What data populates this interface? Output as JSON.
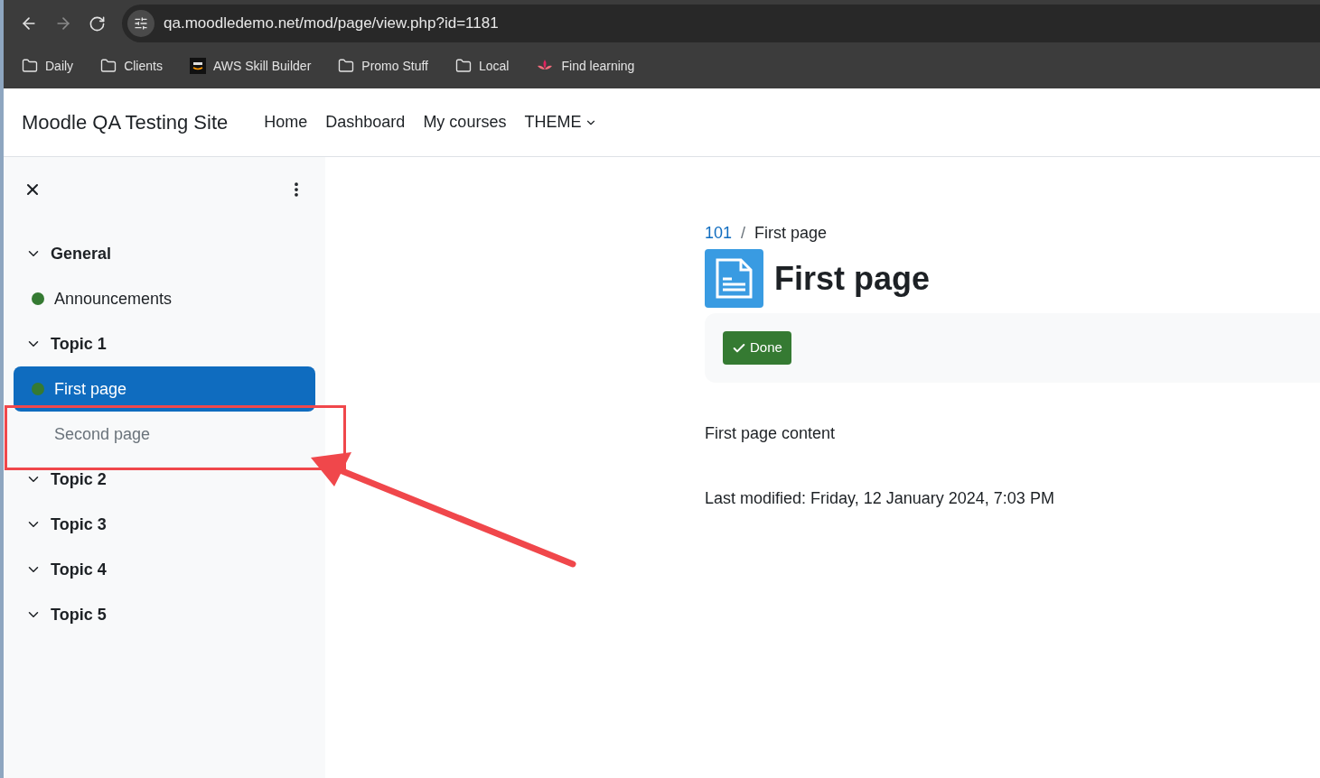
{
  "browser": {
    "url": "qa.moodledemo.net/mod/page/view.php?id=1181",
    "bookmarks": [
      {
        "label": "Daily",
        "kind": "folder"
      },
      {
        "label": "Clients",
        "kind": "folder"
      },
      {
        "label": "AWS Skill Builder",
        "kind": "aws"
      },
      {
        "label": "Promo Stuff",
        "kind": "folder"
      },
      {
        "label": "Local",
        "kind": "folder"
      },
      {
        "label": "Find learning",
        "kind": "app"
      }
    ]
  },
  "navbar": {
    "site_name": "Moodle QA Testing Site",
    "links": [
      {
        "label": "Home",
        "kind": "link"
      },
      {
        "label": "Dashboard",
        "kind": "link"
      },
      {
        "label": "My courses",
        "kind": "link"
      },
      {
        "label": "THEME",
        "kind": "dropdown"
      }
    ]
  },
  "course_index": {
    "sections": [
      {
        "title": "General",
        "expanded": true,
        "children": [
          {
            "title": "Announcements",
            "completed": true,
            "selected": false,
            "disabled": false
          }
        ]
      },
      {
        "title": "Topic 1",
        "expanded": true,
        "children": [
          {
            "title": "First page",
            "completed": true,
            "selected": true,
            "disabled": false
          },
          {
            "title": "Second page",
            "completed": false,
            "selected": false,
            "disabled": true
          }
        ]
      },
      {
        "title": "Topic 2",
        "expanded": true
      },
      {
        "title": "Topic 3",
        "expanded": true
      },
      {
        "title": "Topic 4",
        "expanded": true
      },
      {
        "title": "Topic 5",
        "expanded": true
      }
    ]
  },
  "main": {
    "breadcrumb_separator": "/",
    "breadcrumb": [
      {
        "label": "101",
        "kind": "link"
      },
      {
        "label": "First page",
        "kind": "current"
      }
    ],
    "title": "First page",
    "completion": {
      "label": "Done",
      "done": true
    },
    "content": "First page content",
    "last_modified": "Last modified: Friday, 12 January 2024, 7:03 PM"
  }
}
